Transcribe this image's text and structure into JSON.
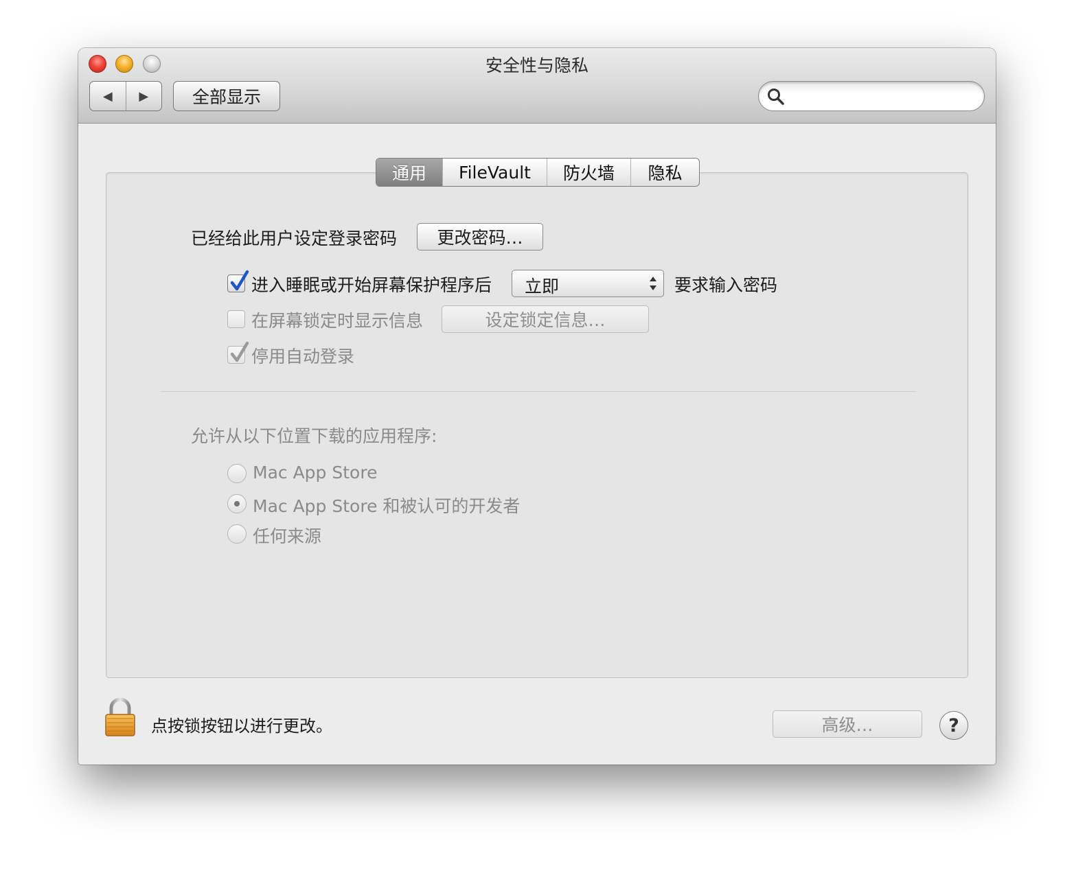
{
  "window": {
    "title": "安全性与隐私"
  },
  "toolbar": {
    "back_icon": "◀",
    "forward_icon": "▶",
    "show_all_label": "全部显示",
    "search_placeholder": ""
  },
  "tabs": [
    {
      "label": "通用",
      "active": true
    },
    {
      "label": "FileVault",
      "active": false
    },
    {
      "label": "防火墙",
      "active": false
    },
    {
      "label": "隐私",
      "active": false
    }
  ],
  "general": {
    "password_set_text": "已经给此用户设定登录密码",
    "change_password_label": "更改密码…",
    "require_password": {
      "checked": true,
      "label": "进入睡眠或开始屏幕保护程序后",
      "delay_value": "立即",
      "suffix": "要求输入密码"
    },
    "lock_message": {
      "checked": false,
      "enabled": false,
      "label": "在屏幕锁定时显示信息",
      "button_label": "设定锁定信息…"
    },
    "disable_autologin": {
      "checked": true,
      "enabled": false,
      "label": "停用自动登录"
    },
    "allow_apps_heading": "允许从以下位置下载的应用程序:",
    "allow_options": [
      {
        "label": "Mac App Store",
        "selected": false
      },
      {
        "label": "Mac App Store 和被认可的开发者",
        "selected": true
      },
      {
        "label": "任何来源",
        "selected": false
      }
    ]
  },
  "footer": {
    "lock_text": "点按锁按钮以进行更改。",
    "advanced_label": "高级…",
    "help_label": "?"
  },
  "colors": {
    "accent_check": "#1f55c7",
    "lock_gold": "#e8a33a"
  }
}
